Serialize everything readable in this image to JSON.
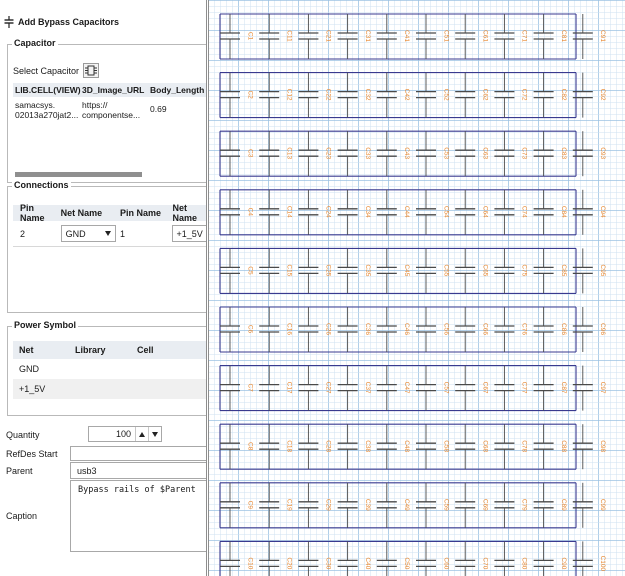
{
  "panel": {
    "title": "Add Bypass Capacitors"
  },
  "capacitor": {
    "legend": "Capacitor",
    "select_label": "Select Capacitor",
    "columns": [
      "LIB.CELL(VIEW)",
      "3D_Image_URL",
      "Body_Length"
    ],
    "row": {
      "lib_cell_line1": "samacsys.",
      "lib_cell_line2": "02013a270jat2...",
      "url_line1": "https://",
      "url_line2": "componentse...",
      "body_length": "0.69"
    }
  },
  "connections": {
    "legend": "Connections",
    "columns": [
      "Pin Name",
      "Net Name",
      "Pin Name",
      "Net Name"
    ],
    "rows": [
      {
        "pin1": "2",
        "net1": "GND",
        "pin2": "1",
        "net2": "+1_5V"
      }
    ]
  },
  "power_symbol": {
    "legend": "Power Symbol",
    "columns": [
      "Net",
      "Library",
      "Cell"
    ],
    "rows": [
      {
        "net": "GND",
        "library": "",
        "cell": ""
      },
      {
        "net": "+1_5V",
        "library": "",
        "cell": ""
      }
    ]
  },
  "form": {
    "quantity_label": "Quantity",
    "quantity_value": "100",
    "refdes_label": "RefDes Start",
    "refdes_value": "",
    "parent_label": "Parent",
    "parent_value": "usb3",
    "caption_label": "Caption",
    "caption_value": "Bypass rails of $Parent"
  },
  "schematic": {
    "rows": [
      [
        "C1",
        "C11",
        "C21",
        "C31",
        "C41",
        "C51",
        "C61",
        "C71",
        "C81",
        "C91"
      ],
      [
        "C2",
        "C12",
        "C22",
        "C32",
        "C42",
        "C52",
        "C62",
        "C72",
        "C82",
        "C92"
      ],
      [
        "C3",
        "C13",
        "C23",
        "C33",
        "C43",
        "C53",
        "C63",
        "C73",
        "C83",
        "C93"
      ],
      [
        "C4",
        "C14",
        "C24",
        "C34",
        "C44",
        "C54",
        "C64",
        "C74",
        "C84",
        "C94"
      ],
      [
        "C5",
        "C15",
        "C25",
        "C35",
        "C45",
        "C55",
        "C65",
        "C75",
        "C85",
        "C95"
      ],
      [
        "C6",
        "C16",
        "C26",
        "C36",
        "C46",
        "C56",
        "C66",
        "C76",
        "C86",
        "C96"
      ],
      [
        "C7",
        "C17",
        "C27",
        "C37",
        "C47",
        "C57",
        "C67",
        "C77",
        "C87",
        "C97"
      ],
      [
        "C8",
        "C18",
        "C28",
        "C38",
        "C48",
        "C58",
        "C68",
        "C78",
        "C88",
        "C98"
      ],
      [
        "C9",
        "C19",
        "C29",
        "C39",
        "C49",
        "C59",
        "C69",
        "C79",
        "C89",
        "C99"
      ],
      [
        "C10",
        "C20",
        "C30",
        "C40",
        "C50",
        "C60",
        "C70",
        "C80",
        "C90",
        "C100"
      ]
    ]
  },
  "colors": {
    "grid_minor": "#cfe2f2",
    "grid_major": "#9ec3e3",
    "wire": "#3a3a8f",
    "symbol": "#4a4a4a",
    "refdes": "#e8872e"
  }
}
